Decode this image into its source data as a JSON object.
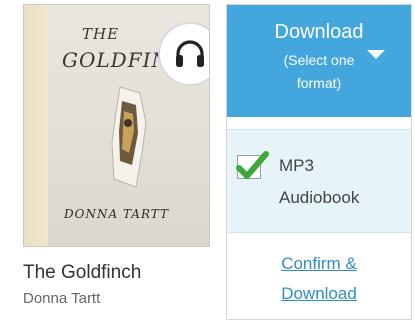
{
  "book": {
    "cover": {
      "title_line1": "THE",
      "title_line2": "GOLDFINCH",
      "author": "DONNA TARTT"
    },
    "title": "The Goldfinch",
    "author": "Donna Tartt",
    "badge_icon": "headphones-icon"
  },
  "download": {
    "button_label": "Download",
    "button_sub1": "(Select one",
    "button_sub2": "format)",
    "caret_icon": "caret-down-icon",
    "format": {
      "line1": "MP3",
      "line2": "Audiobook",
      "checked": true,
      "check_icon": "check-icon"
    },
    "confirm_line1": "Confirm &",
    "confirm_line2": "Download"
  },
  "colors": {
    "accent": "#43a6dd",
    "link": "#2f8ec4",
    "check": "#3fa83a",
    "selected_bg": "#e6f4fa"
  }
}
